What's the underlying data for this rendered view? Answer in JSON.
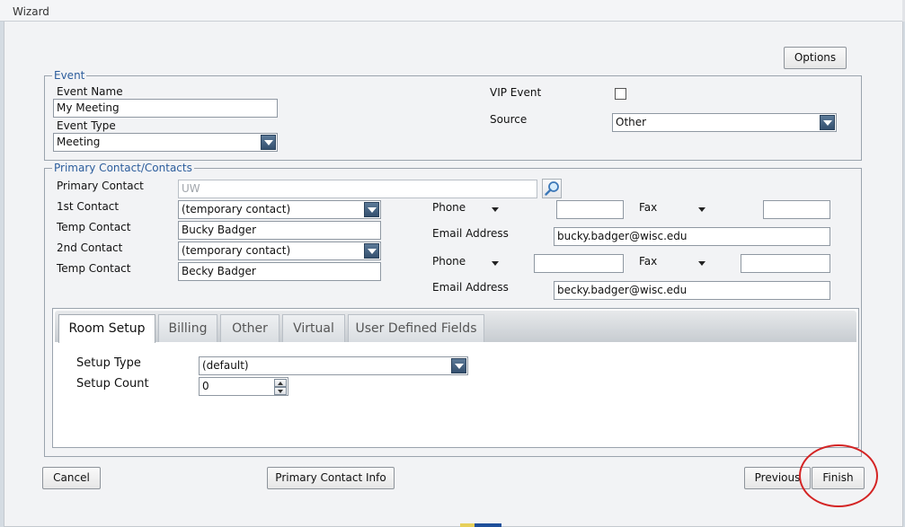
{
  "window": {
    "title": "Wizard"
  },
  "toolbar": {
    "options_label": "Options"
  },
  "event_group": {
    "legend": "Event",
    "event_name_label": "Event Name",
    "event_name_value": "My Meeting",
    "event_type_label": "Event Type",
    "event_type_value": "Meeting",
    "vip_label": "VIP Event",
    "vip_checked": false,
    "source_label": "Source",
    "source_value": "Other"
  },
  "contacts_group": {
    "legend": "Primary Contact/Contacts",
    "primary_contact_label": "Primary Contact",
    "primary_contact_value": "UW",
    "first_contact_label": "1st Contact",
    "first_contact_value": "(temporary contact)",
    "temp_contact1_label": "Temp Contact",
    "temp_contact1_value": "Bucky Badger",
    "second_contact_label": "2nd Contact",
    "second_contact_value": "(temporary contact)",
    "temp_contact2_label": "Temp Contact",
    "temp_contact2_value": "Becky Badger",
    "phone1_label": "Phone",
    "phone1_value": "",
    "fax1_label": "Fax",
    "fax1_value": "",
    "email1_label": "Email Address",
    "email1_value": "bucky.badger@wisc.edu",
    "phone2_label": "Phone",
    "phone2_value": "",
    "fax2_label": "Fax",
    "fax2_value": "",
    "email2_label": "Email Address",
    "email2_value": "becky.badger@wisc.edu"
  },
  "tabs": [
    {
      "label": "Room Setup",
      "active": true
    },
    {
      "label": "Billing",
      "active": false
    },
    {
      "label": "Other",
      "active": false
    },
    {
      "label": "Virtual",
      "active": false
    },
    {
      "label": "User Defined Fields",
      "active": false
    }
  ],
  "room_setup": {
    "setup_type_label": "Setup Type",
    "setup_type_value": "(default)",
    "setup_count_label": "Setup Count",
    "setup_count_value": "0"
  },
  "footer": {
    "cancel_label": "Cancel",
    "primary_contact_info_label": "Primary Contact Info",
    "previous_label": "Previous",
    "finish_label": "Finish"
  },
  "colors": {
    "legend": "#2c5d9c",
    "dropdown_arrow": "#34506f",
    "highlight_circle": "#d42424"
  },
  "icons": {
    "dropdown": "chevron-down-icon",
    "lookup": "magnifier-icon",
    "spinner_up": "arrow-up-icon",
    "spinner_down": "arrow-down-icon"
  }
}
